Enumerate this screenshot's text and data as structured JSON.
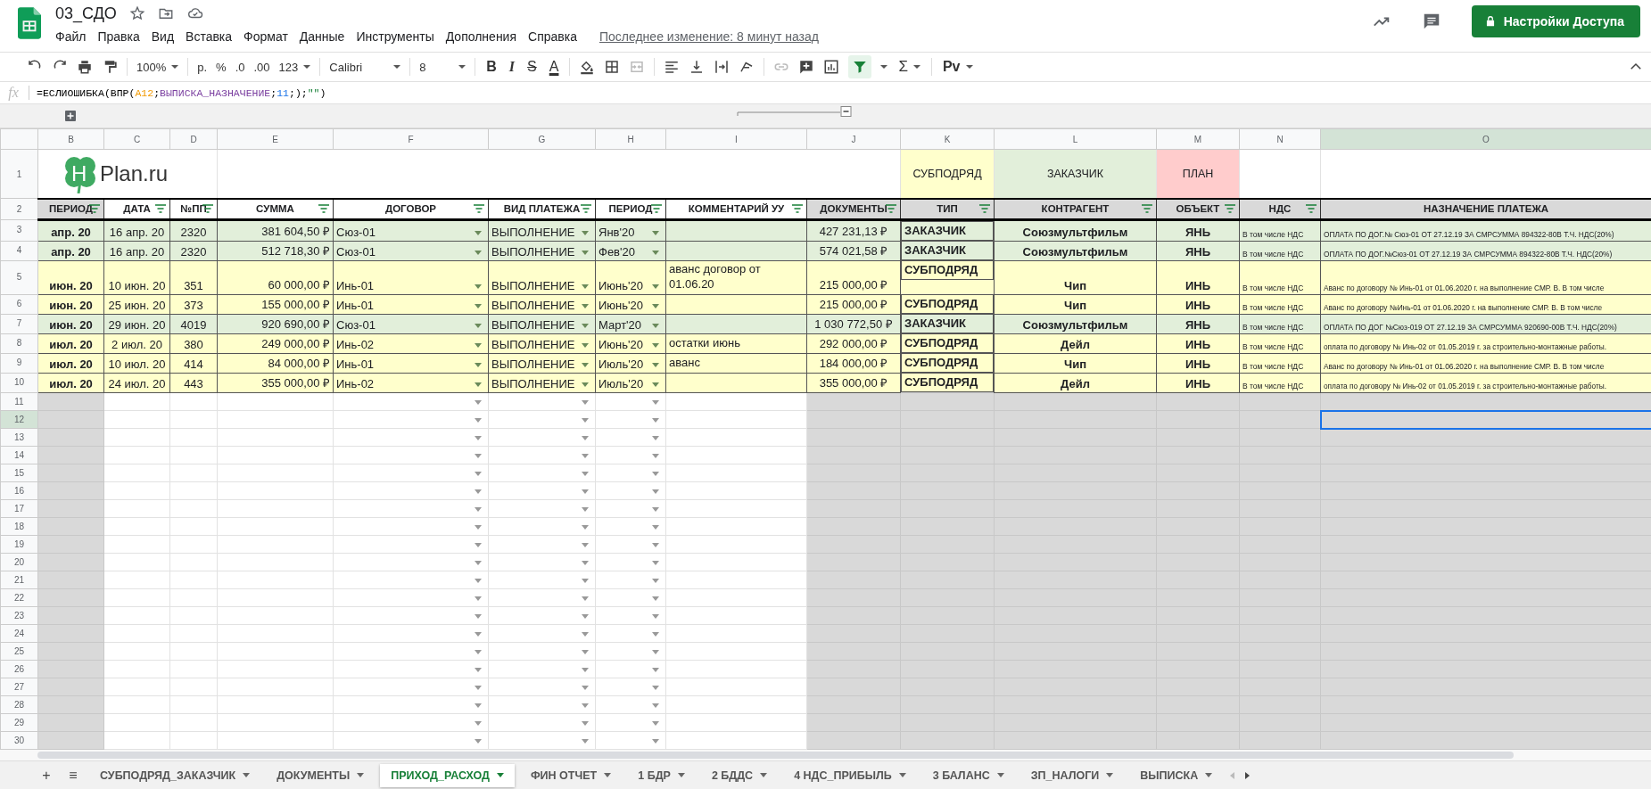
{
  "document": {
    "title": "03_СДО",
    "last_edit": "Последнее изменение: 8 минут назад"
  },
  "menu": [
    "Файл",
    "Правка",
    "Вид",
    "Вставка",
    "Формат",
    "Данные",
    "Инструменты",
    "Дополнения",
    "Справка"
  ],
  "share_button": "Настройки Доступа",
  "toolbar": {
    "zoom": "100%",
    "currency": "р.",
    "percent": "%",
    "dec_less": ".0",
    "dec_more": ".00",
    "number_format": "123",
    "font": "Calibri",
    "font_size": "8",
    "bold": "B",
    "italic": "I",
    "strike": "S",
    "text_color": "A",
    "sigma": "Σ",
    "input_tools": "Рv",
    "filter_on": true
  },
  "formula_bar": {
    "label": "fx",
    "tokens": [
      {
        "kind": "plain",
        "text": "=ЕСЛИОШИБКА(ВПР("
      },
      {
        "kind": "ref",
        "text": "A12"
      },
      {
        "kind": "plain",
        "text": ";"
      },
      {
        "kind": "name",
        "text": "ВЫПИСКА_НАЗНАЧЕНИЕ"
      },
      {
        "kind": "plain",
        "text": ";"
      },
      {
        "kind": "number",
        "text": "11"
      },
      {
        "kind": "plain",
        "text": ";);"
      },
      {
        "kind": "string",
        "text": "\"\""
      },
      {
        "kind": "plain",
        "text": ")"
      }
    ]
  },
  "columns": [
    {
      "letter": "B",
      "selected": false
    },
    {
      "letter": "C",
      "selected": false
    },
    {
      "letter": "D",
      "selected": false
    },
    {
      "letter": "E",
      "selected": false
    },
    {
      "letter": "F",
      "selected": false
    },
    {
      "letter": "G",
      "selected": false
    },
    {
      "letter": "H",
      "selected": false
    },
    {
      "letter": "I",
      "selected": false
    },
    {
      "letter": "J",
      "selected": false
    },
    {
      "letter": "K",
      "selected": false
    },
    {
      "letter": "L",
      "selected": false
    },
    {
      "letter": "M",
      "selected": false
    },
    {
      "letter": "N",
      "selected": false
    },
    {
      "letter": "O",
      "selected": true
    }
  ],
  "row1": {
    "num": "1",
    "logo": {
      "mark": "H",
      "text": "Plan.ru"
    },
    "legend": [
      {
        "text": "СУБПОДРЯД",
        "color": "#ffffcc"
      },
      {
        "text": "ЗАКАЗЧИК",
        "color": "#e2efda"
      },
      {
        "text": "ПЛАН",
        "color": "#ffcccc"
      }
    ]
  },
  "headers": {
    "num": "2",
    "cells": [
      {
        "text": "ПЕРИОД",
        "filter": true,
        "shaded": true
      },
      {
        "text": "ДАТА",
        "filter": true,
        "shaded": false
      },
      {
        "text": "№ПП",
        "filter": true,
        "shaded": false
      },
      {
        "text": "СУММА",
        "filter": true,
        "shaded": false
      },
      {
        "text": "ДОГОВОР",
        "filter": true,
        "shaded": false
      },
      {
        "text": "ВИД ПЛАТЕЖА",
        "filter": true,
        "shaded": false
      },
      {
        "text": "ПЕРИОД",
        "filter": true,
        "shaded": false
      },
      {
        "text": "КОММЕНТАРИЙ УУ",
        "filter": true,
        "shaded": false
      },
      {
        "text": "ДОКУМЕНТЫ",
        "filter": true,
        "shaded": true
      },
      {
        "text": "ТИП",
        "filter": true,
        "shaded": true
      },
      {
        "text": "КОНТРАГЕНТ",
        "filter": true,
        "shaded": true
      },
      {
        "text": "ОБЪЕКТ",
        "filter": true,
        "shaded": true
      },
      {
        "text": "НДС",
        "filter": true,
        "shaded": true
      },
      {
        "text": "НАЗНАЧЕНИЕ ПЛАТЕЖА",
        "filter": false,
        "shaded": true
      }
    ]
  },
  "rows": [
    {
      "num": "3",
      "kind": "customer",
      "period": "апр. 20",
      "date": "16 апр. 20",
      "number": "2320",
      "amount": "381 604,50 ₽",
      "contract": "Сюз-01",
      "payment_type": "ВЫПОЛНЕНИЕ",
      "month": "Янв'20",
      "documents": "427 231,13 ₽",
      "type": "ЗАКАЗЧИК",
      "counterparty": "Союзмультфильм",
      "object": "ЯНЬ",
      "vat": "В том числе НДС",
      "purpose": "ОПЛАТА ПО ДОГ.№ Сюз-01 ОТ 27.12.19 ЗА СМРСУММА 894322-80В Т.Ч. НДС(20%)"
    },
    {
      "num": "4",
      "kind": "customer",
      "period": "апр. 20",
      "date": "16 апр. 20",
      "number": "2320",
      "amount": "512 718,30 ₽",
      "contract": "Сюз-01",
      "payment_type": "ВЫПОЛНЕНИЕ",
      "month": "Фев'20",
      "documents": "574 021,58 ₽",
      "type": "ЗАКАЗЧИК",
      "counterparty": "Союзмультфильм",
      "object": "ЯНЬ",
      "vat": "В том числе НДС",
      "purpose": "ОПЛАТА ПО ДОГ.№Сюз-01 ОТ 27.12.19 ЗА СМРСУММА 894322-80В Т.Ч. НДС(20%)"
    },
    {
      "num": "5",
      "kind": "subcontract",
      "period": "июн. 20",
      "date": "10 июн. 20",
      "number": "351",
      "amount": "60 000,00 ₽",
      "contract": "Инь-01",
      "payment_type": "ВЫПОЛНЕНИЕ",
      "month": "Июнь'20",
      "comment": "аванс договор от 01.06.20",
      "documents": "215 000,00 ₽",
      "type": "СУБПОДРЯД",
      "counterparty": "Чип",
      "object": "ИНЬ",
      "vat": "В том числе НДС",
      "purpose": "Аванс по договору № Инь-01 от 01.06.2020 г. на выполнение СМР. В. В том числе"
    },
    {
      "num": "6",
      "kind": "subcontract",
      "period": "июн. 20",
      "date": "25 июн. 20",
      "number": "373",
      "amount": "155 000,00 ₽",
      "contract": "Инь-01",
      "payment_type": "ВЫПОЛНЕНИЕ",
      "month": "Июнь'20",
      "documents": "215 000,00 ₽",
      "type": "СУБПОДРЯД",
      "counterparty": "Чип",
      "object": "ИНЬ",
      "vat": "В том числе НДС",
      "purpose": "Аванс по договору №Инь-01 от 01.06.2020 г. на выполнение СМР. В. В том числе"
    },
    {
      "num": "7",
      "kind": "customer",
      "period": "июн. 20",
      "date": "29 июн. 20",
      "number": "4019",
      "amount": "920 690,00 ₽",
      "contract": "Сюз-01",
      "payment_type": "ВЫПОЛНЕНИЕ",
      "month": "Март'20",
      "documents": "1 030 772,50 ₽",
      "type": "ЗАКАЗЧИК",
      "counterparty": "Союзмультфильм",
      "object": "ЯНЬ",
      "vat": "В том числе НДС",
      "purpose": "ОПЛАТА ПО ДОГ №Сюз-019 ОТ 27.12.19 ЗА СМРСУММА 920690-00В Т.Ч. НДС(20%)"
    },
    {
      "num": "8",
      "kind": "subcontract",
      "period": "июл. 20",
      "date": "2 июл. 20",
      "number": "380",
      "amount": "249 000,00 ₽",
      "contract": "Инь-02",
      "payment_type": "ВЫПОЛНЕНИЕ",
      "month": "Июнь'20",
      "comment": "остатки июнь",
      "documents": "292 000,00 ₽",
      "type": "СУБПОДРЯД",
      "counterparty": "Дейл",
      "object": "ИНЬ",
      "vat": "В том числе НДС",
      "purpose": "оплата по договору № Инь-02 от 01.05.2019 г. за строительно-монтажные работы."
    },
    {
      "num": "9",
      "kind": "subcontract",
      "period": "июл. 20",
      "date": "10 июл. 20",
      "number": "414",
      "amount": "84 000,00 ₽",
      "contract": "Инь-01",
      "payment_type": "ВЫПОЛНЕНИЕ",
      "month": "Июль'20",
      "comment": "аванс",
      "documents": "184 000,00 ₽",
      "type": "СУБПОДРЯД",
      "counterparty": "Чип",
      "object": "ИНЬ",
      "vat": "В том числе НДС",
      "purpose": "Аванс по договору № Инь-01 от 01.06.2020 г. на выполнение СМР. В. В том числе"
    },
    {
      "num": "10",
      "kind": "subcontract",
      "period": "июл. 20",
      "date": "24 июл. 20",
      "number": "443",
      "amount": "355 000,00 ₽",
      "contract": "Инь-02",
      "payment_type": "ВЫПОЛНЕНИЕ",
      "month": "Июль'20",
      "documents": "355 000,00 ₽",
      "type": "СУБПОДРЯД",
      "counterparty": "Дейл",
      "object": "ИНЬ",
      "vat": "В том числе НДС",
      "purpose": "оплата по договору № Инь-02 от 01.05.2019 г. за строительно-монтажные работы."
    }
  ],
  "empty_rows": [
    {
      "num": "11",
      "selected": false
    },
    {
      "num": "12",
      "selected": true
    },
    {
      "num": "13",
      "selected": false
    },
    {
      "num": "14",
      "selected": false
    },
    {
      "num": "15",
      "selected": false
    },
    {
      "num": "16",
      "selected": false
    },
    {
      "num": "17",
      "selected": false
    },
    {
      "num": "18",
      "selected": false
    },
    {
      "num": "19",
      "selected": false
    },
    {
      "num": "20",
      "selected": false
    },
    {
      "num": "21",
      "selected": false
    },
    {
      "num": "22",
      "selected": false
    },
    {
      "num": "23",
      "selected": false
    },
    {
      "num": "24",
      "selected": false
    },
    {
      "num": "25",
      "selected": false
    },
    {
      "num": "26",
      "selected": false
    },
    {
      "num": "27",
      "selected": false
    },
    {
      "num": "28",
      "selected": false
    },
    {
      "num": "29",
      "selected": false
    },
    {
      "num": "30",
      "selected": false
    }
  ],
  "sheet_bar": {
    "add": "+",
    "list": "≡",
    "tabs": [
      {
        "label": "СУБПОДРЯД_ЗАКАЗЧИК",
        "selected": false
      },
      {
        "label": "ДОКУМЕНТЫ",
        "selected": false
      },
      {
        "label": "ПРИХОД_РАСХОД",
        "selected": true
      },
      {
        "label": "ФИН ОТЧЕТ",
        "selected": false
      },
      {
        "label": "1 БДР",
        "selected": false
      },
      {
        "label": "2 БДДС",
        "selected": false
      },
      {
        "label": "4 НДС_ПРИБЫЛЬ",
        "selected": false
      },
      {
        "label": "3 БАЛАНС",
        "selected": false
      },
      {
        "label": "ЗП_НАЛОГИ",
        "selected": false
      },
      {
        "label": "ВЫПИСКА",
        "selected": false
      }
    ]
  }
}
